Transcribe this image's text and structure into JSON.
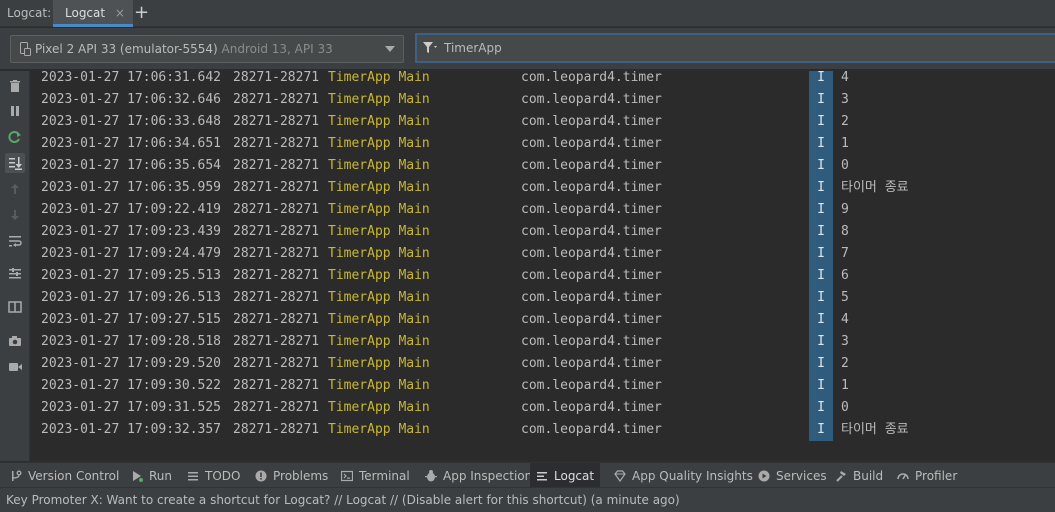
{
  "top_bar": {
    "title": "Logcat:",
    "tab_label": "Logcat",
    "tab_close": "×",
    "add_tab": "+"
  },
  "filter_row": {
    "device_name": "Pixel 2 API 33 (emulator-5554)",
    "device_detail": "Android 13, API 33",
    "filter_text": "TimerApp"
  },
  "log_rows": [
    {
      "ts": "2023-01-27 17:06:31.642",
      "pid": "28271-28271",
      "tag": "TimerApp Main",
      "pkg": "com.leopard4.timer",
      "level": "I",
      "msg": "4"
    },
    {
      "ts": "2023-01-27 17:06:32.646",
      "pid": "28271-28271",
      "tag": "TimerApp Main",
      "pkg": "com.leopard4.timer",
      "level": "I",
      "msg": "3"
    },
    {
      "ts": "2023-01-27 17:06:33.648",
      "pid": "28271-28271",
      "tag": "TimerApp Main",
      "pkg": "com.leopard4.timer",
      "level": "I",
      "msg": "2"
    },
    {
      "ts": "2023-01-27 17:06:34.651",
      "pid": "28271-28271",
      "tag": "TimerApp Main",
      "pkg": "com.leopard4.timer",
      "level": "I",
      "msg": "1"
    },
    {
      "ts": "2023-01-27 17:06:35.654",
      "pid": "28271-28271",
      "tag": "TimerApp Main",
      "pkg": "com.leopard4.timer",
      "level": "I",
      "msg": "0"
    },
    {
      "ts": "2023-01-27 17:06:35.959",
      "pid": "28271-28271",
      "tag": "TimerApp Main",
      "pkg": "com.leopard4.timer",
      "level": "I",
      "msg": "타이머 종료"
    },
    {
      "ts": "2023-01-27 17:09:22.419",
      "pid": "28271-28271",
      "tag": "TimerApp Main",
      "pkg": "com.leopard4.timer",
      "level": "I",
      "msg": "9"
    },
    {
      "ts": "2023-01-27 17:09:23.439",
      "pid": "28271-28271",
      "tag": "TimerApp Main",
      "pkg": "com.leopard4.timer",
      "level": "I",
      "msg": "8"
    },
    {
      "ts": "2023-01-27 17:09:24.479",
      "pid": "28271-28271",
      "tag": "TimerApp Main",
      "pkg": "com.leopard4.timer",
      "level": "I",
      "msg": "7"
    },
    {
      "ts": "2023-01-27 17:09:25.513",
      "pid": "28271-28271",
      "tag": "TimerApp Main",
      "pkg": "com.leopard4.timer",
      "level": "I",
      "msg": "6"
    },
    {
      "ts": "2023-01-27 17:09:26.513",
      "pid": "28271-28271",
      "tag": "TimerApp Main",
      "pkg": "com.leopard4.timer",
      "level": "I",
      "msg": "5"
    },
    {
      "ts": "2023-01-27 17:09:27.515",
      "pid": "28271-28271",
      "tag": "TimerApp Main",
      "pkg": "com.leopard4.timer",
      "level": "I",
      "msg": "4"
    },
    {
      "ts": "2023-01-27 17:09:28.518",
      "pid": "28271-28271",
      "tag": "TimerApp Main",
      "pkg": "com.leopard4.timer",
      "level": "I",
      "msg": "3"
    },
    {
      "ts": "2023-01-27 17:09:29.520",
      "pid": "28271-28271",
      "tag": "TimerApp Main",
      "pkg": "com.leopard4.timer",
      "level": "I",
      "msg": "2"
    },
    {
      "ts": "2023-01-27 17:09:30.522",
      "pid": "28271-28271",
      "tag": "TimerApp Main",
      "pkg": "com.leopard4.timer",
      "level": "I",
      "msg": "1"
    },
    {
      "ts": "2023-01-27 17:09:31.525",
      "pid": "28271-28271",
      "tag": "TimerApp Main",
      "pkg": "com.leopard4.timer",
      "level": "I",
      "msg": "0"
    },
    {
      "ts": "2023-01-27 17:09:32.357",
      "pid": "28271-28271",
      "tag": "TimerApp Main",
      "pkg": "com.leopard4.timer",
      "level": "I",
      "msg": "타이머 종료"
    }
  ],
  "left_tools": [
    {
      "name": "clear-logcat-icon"
    },
    {
      "name": "pause-icon"
    },
    {
      "name": "restart-icon"
    },
    {
      "name": "scroll-to-end-icon",
      "selected": true
    },
    {
      "name": "previous-occurrence-icon"
    },
    {
      "name": "next-occurrence-icon"
    },
    {
      "name": "soft-wrap-icon"
    },
    {
      "name": "format-icon"
    },
    {
      "name": "split-panels-icon"
    },
    {
      "name": "screenshot-icon"
    },
    {
      "name": "screen-record-icon"
    }
  ],
  "tool_windows": [
    {
      "label": "Version Control",
      "icon": "version-control-icon"
    },
    {
      "label": "Run",
      "icon": "run-icon"
    },
    {
      "label": "TODO",
      "icon": "todo-icon"
    },
    {
      "label": "Problems",
      "icon": "problems-icon"
    },
    {
      "label": "Terminal",
      "icon": "terminal-icon"
    },
    {
      "label": "App Inspection",
      "icon": "app-inspection-icon"
    },
    {
      "label": "Logcat",
      "icon": "logcat-icon",
      "active": true
    },
    {
      "label": "App Quality Insights",
      "icon": "app-quality-insights-icon"
    },
    {
      "label": "Services",
      "icon": "services-icon"
    },
    {
      "label": "Build",
      "icon": "build-icon"
    },
    {
      "label": "Profiler",
      "icon": "profiler-icon"
    }
  ],
  "status_bar": {
    "text": "Key Promoter X: Want to create a shortcut for Logcat? // Logcat // (Disable alert for this shortcut) (a minute ago)"
  },
  "colors": {
    "tag": "#c9b82f",
    "level_badge": "#2f5b7c",
    "tab_underline": "#4a88c7",
    "filter_border": "#3d6185",
    "run_green": "#59a869"
  }
}
